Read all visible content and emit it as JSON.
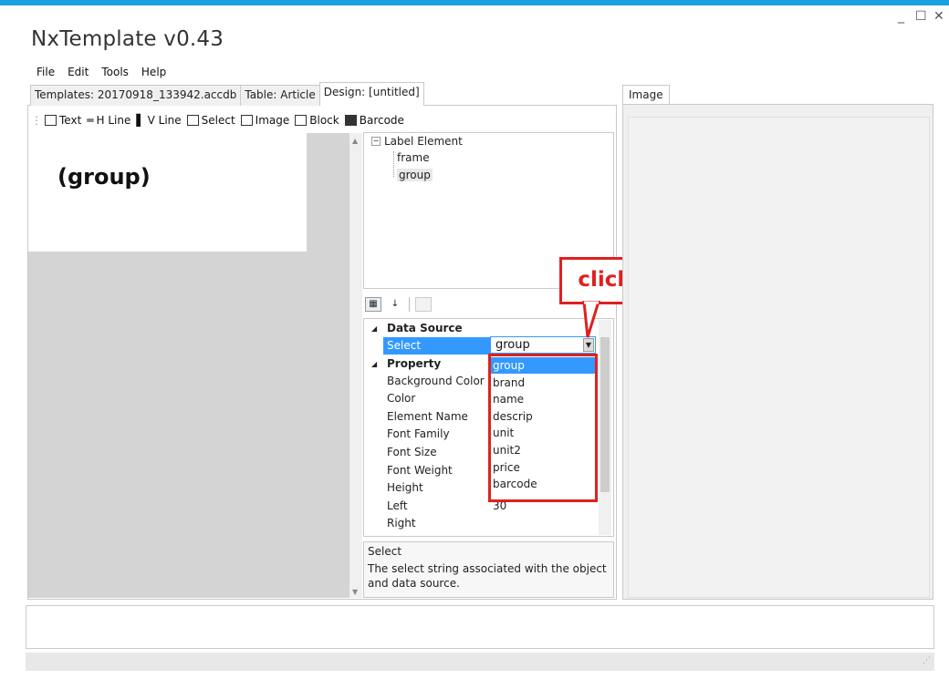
{
  "app": {
    "title": "NxTemplate v0.43"
  },
  "window_controls": {
    "minimize": "_",
    "maximize": "☐",
    "close": "✕"
  },
  "menu": [
    "File",
    "Edit",
    "Tools",
    "Help"
  ],
  "tabs": [
    {
      "label": "Templates: 20170918_133942.accdb"
    },
    {
      "label": "Table: Article"
    },
    {
      "label": "Design: [untitled]"
    }
  ],
  "toolbar": [
    "Text",
    "H Line",
    "V Line",
    "Select",
    "Image",
    "Block",
    "Barcode"
  ],
  "canvas": {
    "element_text": "(group)"
  },
  "tree": {
    "root": "Label Element",
    "children": [
      "frame",
      "group"
    ]
  },
  "properties": {
    "category1": "Data Source",
    "select_label": "Select",
    "category2": "Property",
    "rows": [
      "Background Color",
      "Color",
      "Element Name",
      "Font Family",
      "Font Size",
      "Font Weight",
      "Height",
      "Left",
      "Right"
    ],
    "left_value": "30"
  },
  "combo": {
    "value": "group"
  },
  "dropdown": {
    "options": [
      "group",
      "brand",
      "name",
      "descrip",
      "unit",
      "unit2",
      "price",
      "barcode"
    ]
  },
  "callout": {
    "text": "click here"
  },
  "description": {
    "title": "Select",
    "text": "The select string associated with the object and data source."
  },
  "image_tab": {
    "label": "Image"
  },
  "colors": {
    "accent": "#1ba1e2",
    "highlight": "#e02020",
    "selection": "#3399ff"
  }
}
